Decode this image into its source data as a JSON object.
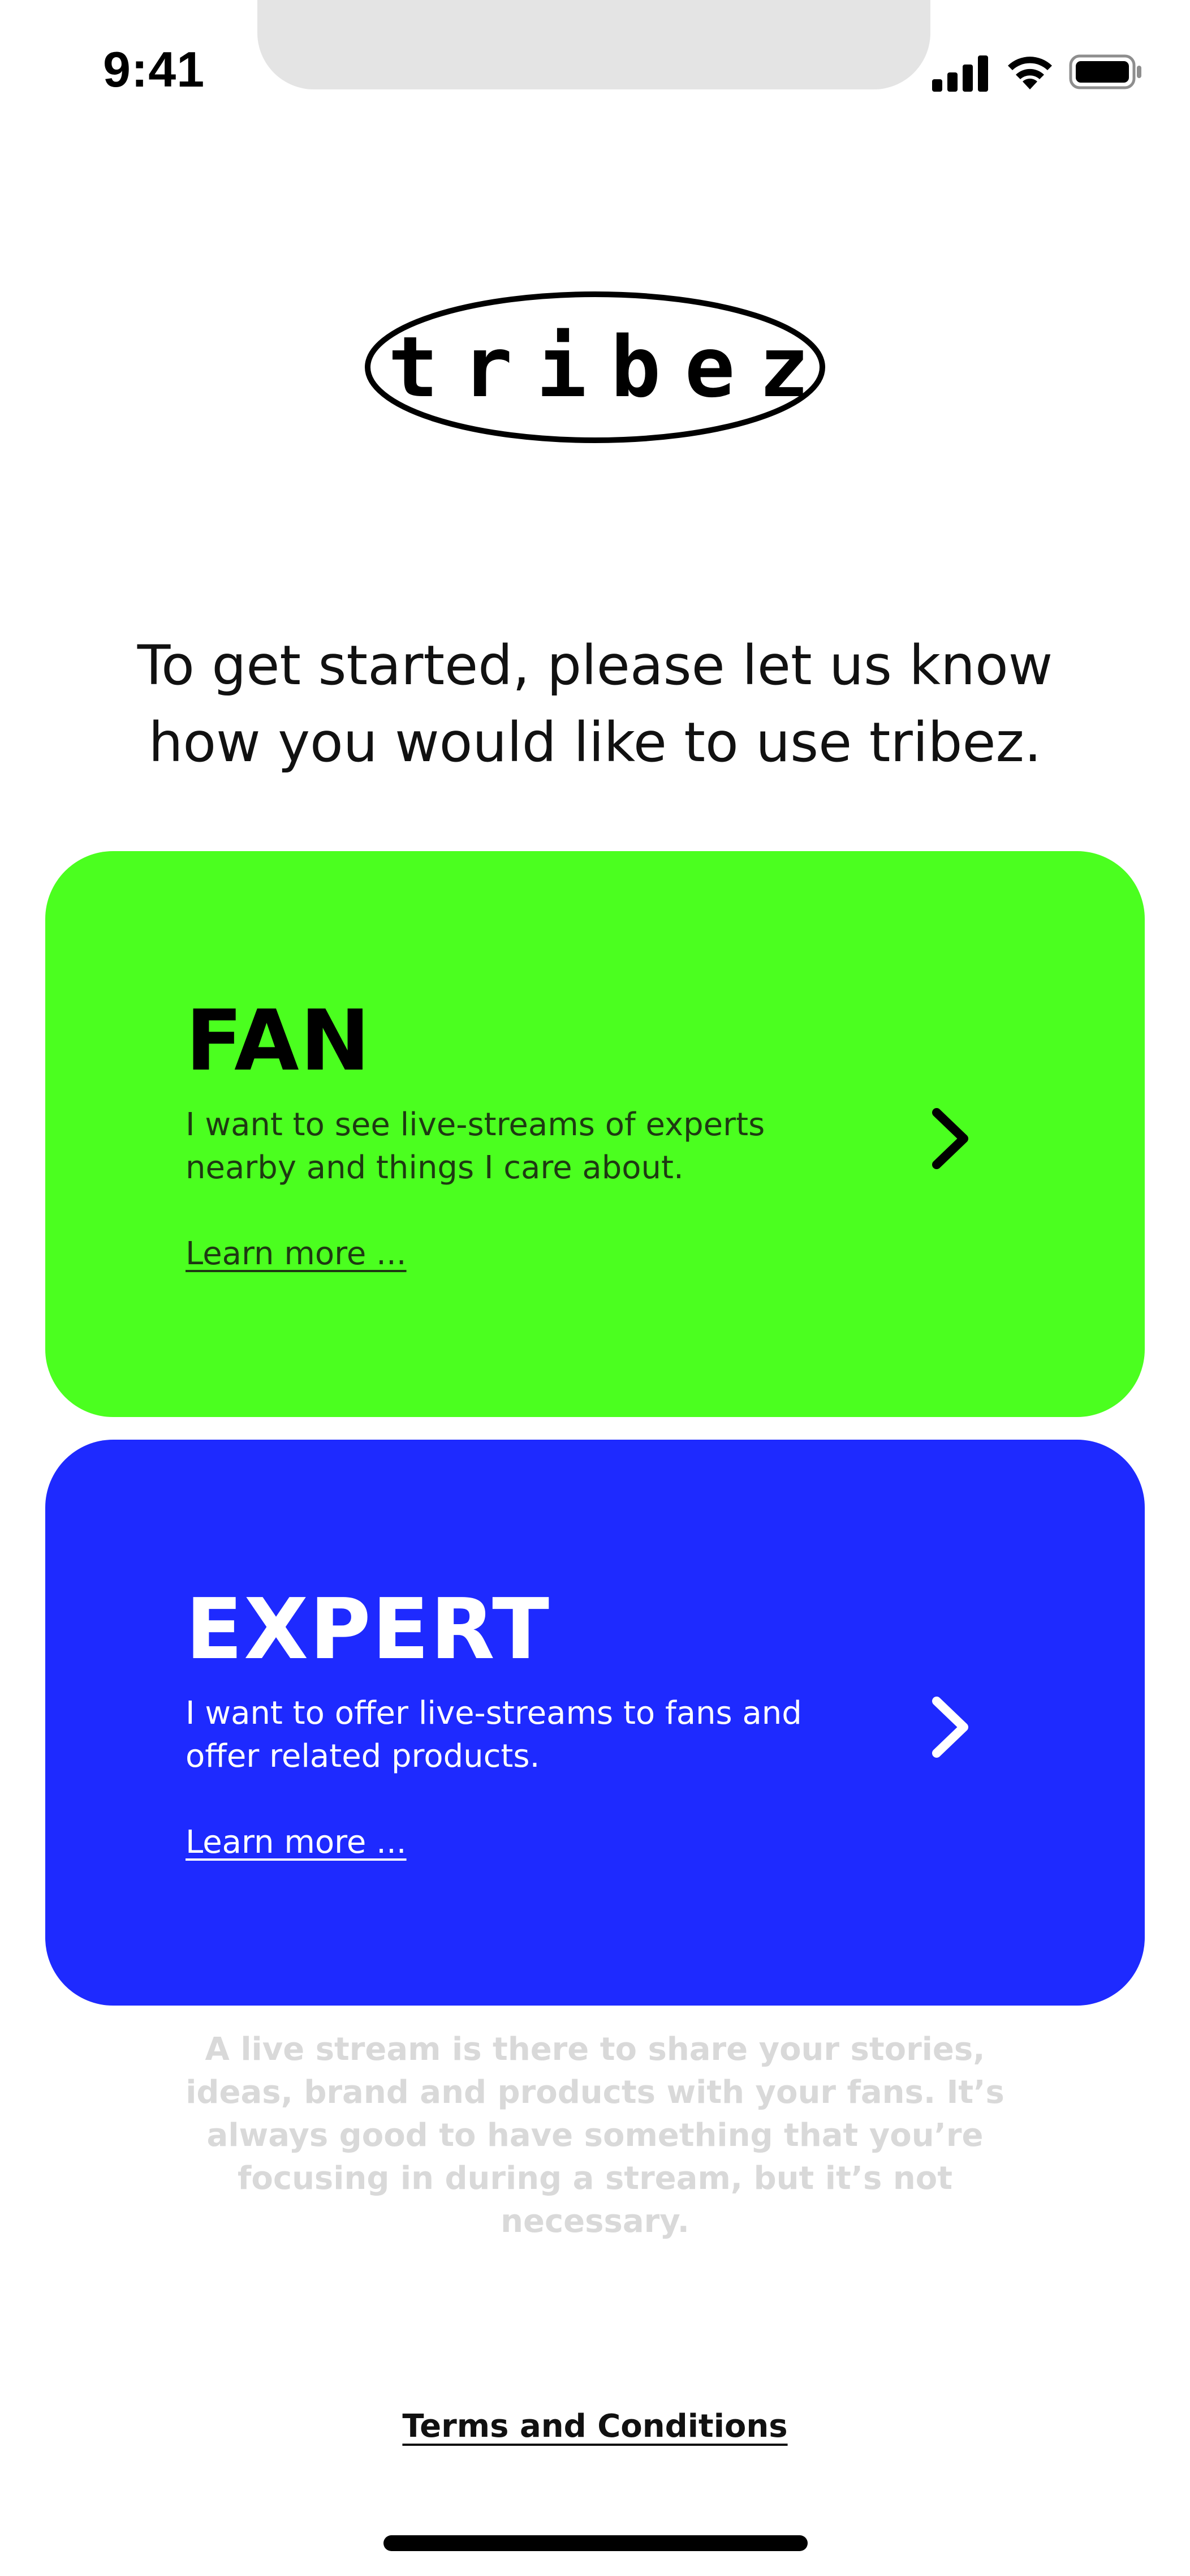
{
  "status_bar": {
    "time": "9:41",
    "icons": [
      "signal-icon",
      "wifi-icon",
      "battery-icon"
    ]
  },
  "logo": {
    "text": "tribez"
  },
  "intro": {
    "text": "To get started, please let us know how you would like to use tribez."
  },
  "cards": [
    {
      "id": "fan",
      "title": "FAN",
      "description": "I want to see live-streams of experts nearby and things I care about.",
      "link": "Learn more ...",
      "background": "#4bff1f",
      "text_color": "#000000",
      "desc_color": "#1e3a12",
      "icon": "chevron-right-icon"
    },
    {
      "id": "expert",
      "title": "EXPERT",
      "description": "I want to offer live-streams to fans and offer related products.",
      "link": "Learn more ...",
      "background": "#1e2aff",
      "text_color": "#ffffff",
      "desc_color": "#ffffff",
      "icon": "chevron-right-icon"
    }
  ],
  "footnote": {
    "text": "A live stream is there to share your stories, ideas, brand and products with your fans. It’s always good to have something that you’re focusing in during a stream, but it’s not necessary.",
    "color": "#d9d9d9"
  },
  "terms": {
    "label": "Terms and Conditions"
  }
}
